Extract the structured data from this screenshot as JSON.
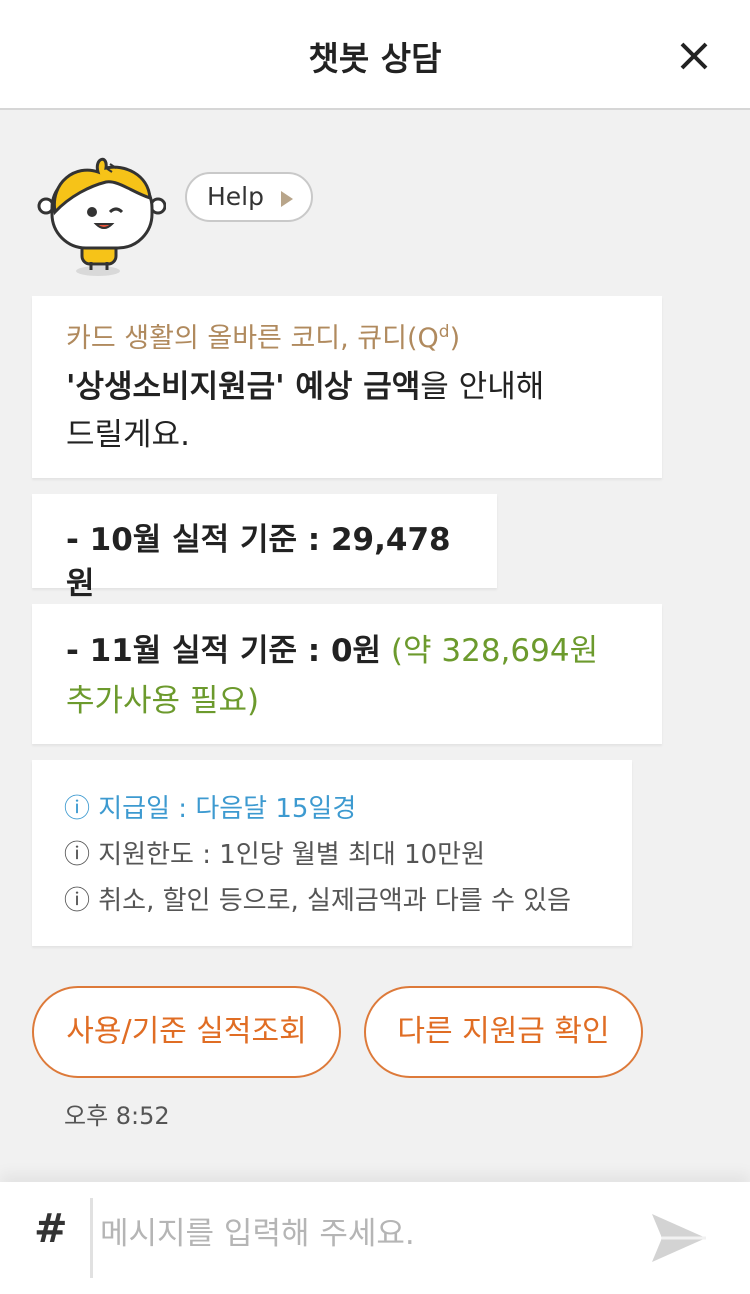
{
  "header": {
    "title": "챗봇 상담"
  },
  "help": {
    "label": "Help"
  },
  "messages": {
    "intro_sub_text": "카드 생활의 올바른 코디, 큐디(Q",
    "intro_sub_sup": "d",
    "intro_sub_tail": ")",
    "intro_bold": "'상생소비지원금' 예상 금액",
    "intro_rest": "을 안내해",
    "intro_line2": "드릴게요.",
    "oct_line": "- 10월 실적 기준 : 29,478원",
    "nov_bold": "- 11월 실적 기준 : 0원",
    "nov_green_1": " (약 328,694원",
    "nov_green_2": "추가사용 필요)",
    "info_pay_date": "ⓘ 지급일 : 다음달 15일경",
    "info_limit": "ⓘ 지원한도 : 1인당 월별 최대 10만원",
    "info_diff": "ⓘ 취소, 할인 등으로, 실제금액과 다를 수 있음"
  },
  "quick_replies": {
    "usage_label": "사용/기준 실적조회",
    "other_label": "다른 지원금 확인"
  },
  "timestamp": "오후 8:52",
  "composer": {
    "hash_label": "#",
    "placeholder": "메시지를 입력해 주세요."
  },
  "colors": {
    "accent_orange": "#e06d24",
    "info_blue": "#3d9ad0",
    "highlight_green": "#6c9a2d",
    "subtitle_brown": "#b08a5e"
  }
}
